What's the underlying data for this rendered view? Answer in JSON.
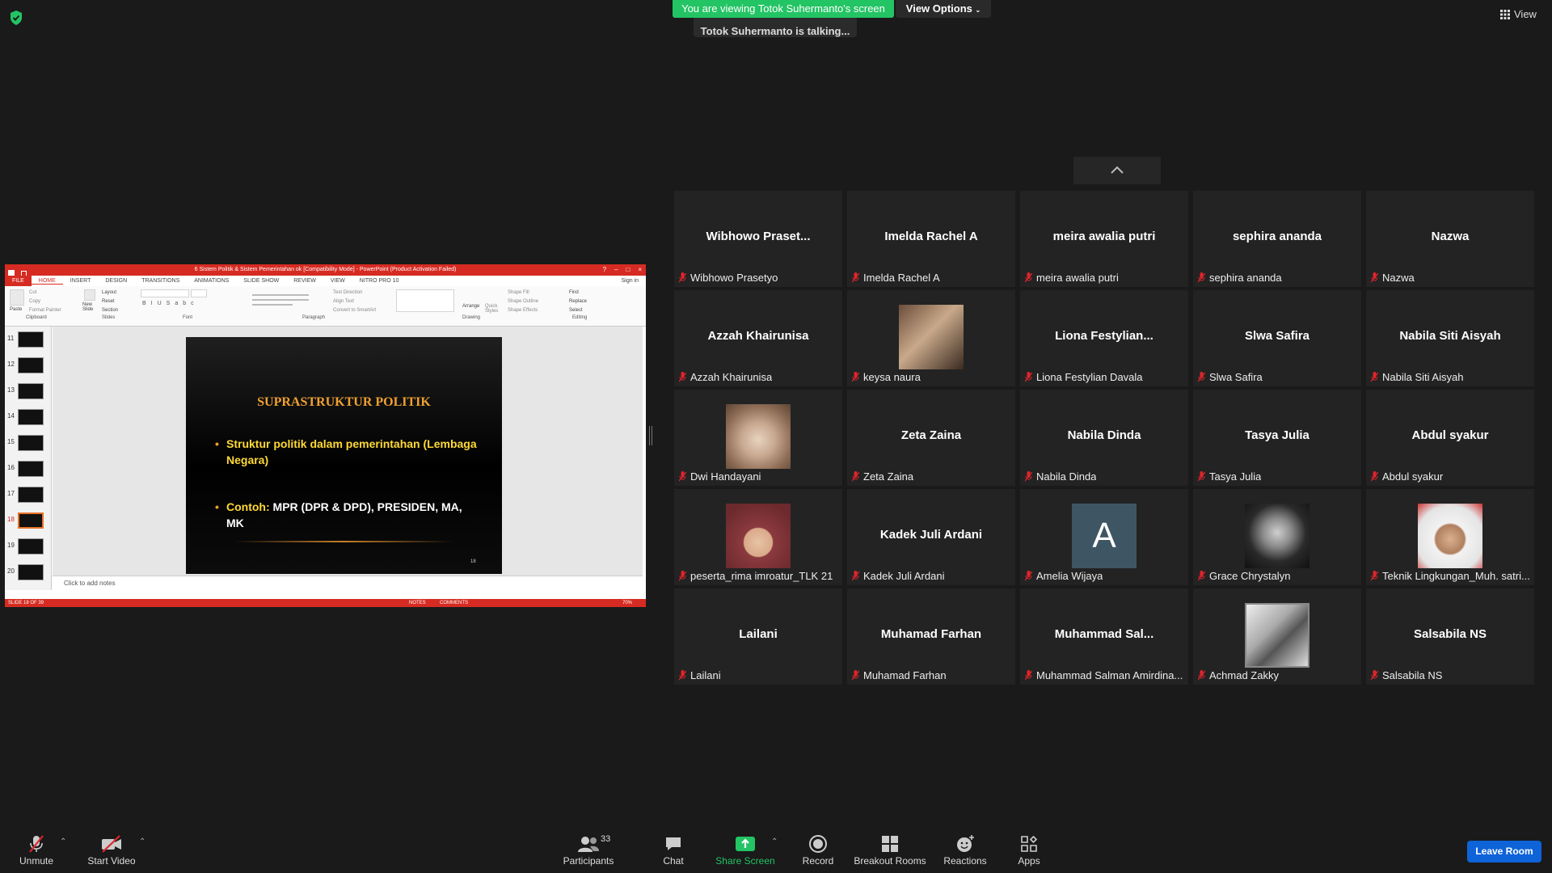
{
  "top": {
    "viewing_banner": "You are viewing Totok Suhermanto's screen",
    "view_options": "View Options",
    "talking": "Totok Suhermanto is talking...",
    "view": "View"
  },
  "ppt": {
    "title": "6 Sistem Politik & Sistem Pemerintahan ok [Compatibility Mode] - PowerPoint (Product Activation Failed)",
    "tabs": [
      "FILE",
      "HOME",
      "INSERT",
      "DESIGN",
      "TRANSITIONS",
      "ANIMATIONS",
      "SLIDE SHOW",
      "REVIEW",
      "VIEW",
      "NITRO PRO 10"
    ],
    "sign_in": "Sign in",
    "ribbon": {
      "paste": "Paste",
      "cut": "Cut",
      "copy": "Copy",
      "format_painter": "Format Painter",
      "new_slide": "New Slide",
      "layout": "Layout",
      "reset": "Reset",
      "section": "Section",
      "text_direction": "Text Direction",
      "align_text": "Align Text",
      "convert_smartart": "Convert to SmartArt",
      "arrange": "Arrange",
      "quick_styles": "Quick Styles",
      "shape_fill": "Shape Fill",
      "shape_outline": "Shape Outline",
      "shape_effects": "Shape Effects",
      "find": "Find",
      "replace": "Replace",
      "select": "Select",
      "groups": [
        "Clipboard",
        "Slides",
        "Font",
        "Paragraph",
        "Drawing",
        "Editing"
      ]
    },
    "thumbs": [
      "11",
      "12",
      "13",
      "14",
      "15",
      "16",
      "17",
      "18",
      "19",
      "20"
    ],
    "selected_thumb": "18",
    "slide": {
      "title": "SUPRASTRUKTUR POLITIK",
      "bullet1": "Struktur politik dalam pemerintahan (Lembaga Negara)",
      "bullet2_prefix": "Contoh:",
      "bullet2_rest": " MPR (DPR & DPD), PRESIDEN, MA, MK",
      "number": "18"
    },
    "notes": "Click to add notes",
    "status": {
      "slide": "SLIDE 18 OF 39",
      "notes": "NOTES",
      "comments": "COMMENTS",
      "zoom": "70%"
    }
  },
  "participants": [
    {
      "name": "Wibhowo  Praset...",
      "label": "Wibhowo Prasetyo"
    },
    {
      "name": "Imelda Rachel A",
      "label": "Imelda Rachel A"
    },
    {
      "name": "meira awalia putri",
      "label": "meira awalia putri"
    },
    {
      "name": "sephira ananda",
      "label": "sephira ananda"
    },
    {
      "name": "Nazwa",
      "label": "Nazwa"
    },
    {
      "name": "Azzah Khairunisa",
      "label": "Azzah Khairunisa"
    },
    {
      "name": "",
      "label": "keysa naura",
      "photo": "woman-photo"
    },
    {
      "name": "Liona  Festylian...",
      "label": "Liona Festylian Davala"
    },
    {
      "name": "Slwa Safira",
      "label": "Slwa Safira"
    },
    {
      "name": "Nabila Siti Aisyah",
      "label": "Nabila Siti Aisyah"
    },
    {
      "name": "",
      "label": "Dwi Handayani",
      "photo": "cat-photo"
    },
    {
      "name": "Zeta Zaina",
      "label": "Zeta Zaina"
    },
    {
      "name": "Nabila Dinda",
      "label": "Nabila Dinda"
    },
    {
      "name": "Tasya Julia",
      "label": "Tasya Julia"
    },
    {
      "name": "Abdul syakur",
      "label": "Abdul syakur"
    },
    {
      "name": "",
      "label": "peserta_rima imroatur_TLK 21",
      "photo": "hijab-photo"
    },
    {
      "name": "Kadek Juli Ardani",
      "label": "Kadek Juli Ardani"
    },
    {
      "name": "",
      "label": "Amelia Wijaya",
      "letter": "A"
    },
    {
      "name": "",
      "label": "Grace Chrystalyn",
      "photo": "bw-portrait-photo"
    },
    {
      "name": "",
      "label": "Teknik Lingkungan_Muh. satri...",
      "photo": "man-cap-photo"
    },
    {
      "name": "Lailani",
      "label": "Lailani"
    },
    {
      "name": "Muhamad Farhan",
      "label": "Muhamad Farhan"
    },
    {
      "name": "Muhammad  Sal...",
      "label": "Muhammad Salman Amirdina..."
    },
    {
      "name": "",
      "label": "Achmad Zakky",
      "photo": "logo-photo"
    },
    {
      "name": "Salsabila NS",
      "label": "Salsabila NS"
    }
  ],
  "toolbar": {
    "unmute": "Unmute",
    "start_video": "Start Video",
    "participants": "Participants",
    "participants_count": "33",
    "chat": "Chat",
    "share_screen": "Share Screen",
    "record": "Record",
    "breakout_rooms": "Breakout Rooms",
    "reactions": "Reactions",
    "apps": "Apps",
    "leave": "Leave Room"
  },
  "colors": {
    "banner_green": "#23c464",
    "accent_blue": "#0e63d8",
    "ppt_red": "#d62b22",
    "slide_title": "#f0a030",
    "slide_yellow": "#ffd933",
    "muted_red": "#e0242c"
  }
}
